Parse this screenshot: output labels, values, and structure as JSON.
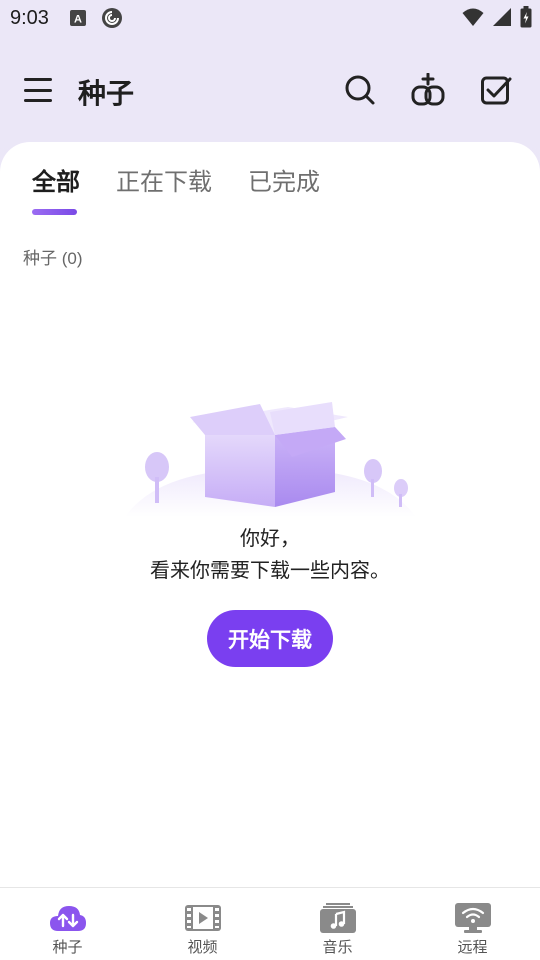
{
  "status_bar": {
    "time": "9:03",
    "icons": [
      "keyboard-a-icon",
      "app-swirl-icon",
      "wifi-icon",
      "cell-signal-icon",
      "battery-charging-icon"
    ]
  },
  "header": {
    "title": "种子",
    "menu_icon": "hamburger-menu-icon",
    "actions": [
      "search-icon",
      "add-link-icon",
      "select-checkbox-icon"
    ]
  },
  "tabs": [
    {
      "label": "全部",
      "active": true
    },
    {
      "label": "正在下载",
      "active": false
    },
    {
      "label": "已完成",
      "active": false
    }
  ],
  "section": {
    "label": "种子 (0)"
  },
  "empty_state": {
    "illustration": "open-box-icon",
    "line1": "你好，",
    "line2": "看来你需要下载一些内容。",
    "button_label": "开始下载"
  },
  "bottom_nav": [
    {
      "label": "种子",
      "icon": "cloud-transfer-icon",
      "active": true
    },
    {
      "label": "视频",
      "icon": "film-icon",
      "active": false
    },
    {
      "label": "音乐",
      "icon": "music-icon",
      "active": false
    },
    {
      "label": "远程",
      "icon": "remote-wifi-icon",
      "active": false
    }
  ],
  "colors": {
    "accent": "#7a3ff0",
    "accent_light": "#b79cf5",
    "nav_icon_gray": "#8a8a8a"
  }
}
